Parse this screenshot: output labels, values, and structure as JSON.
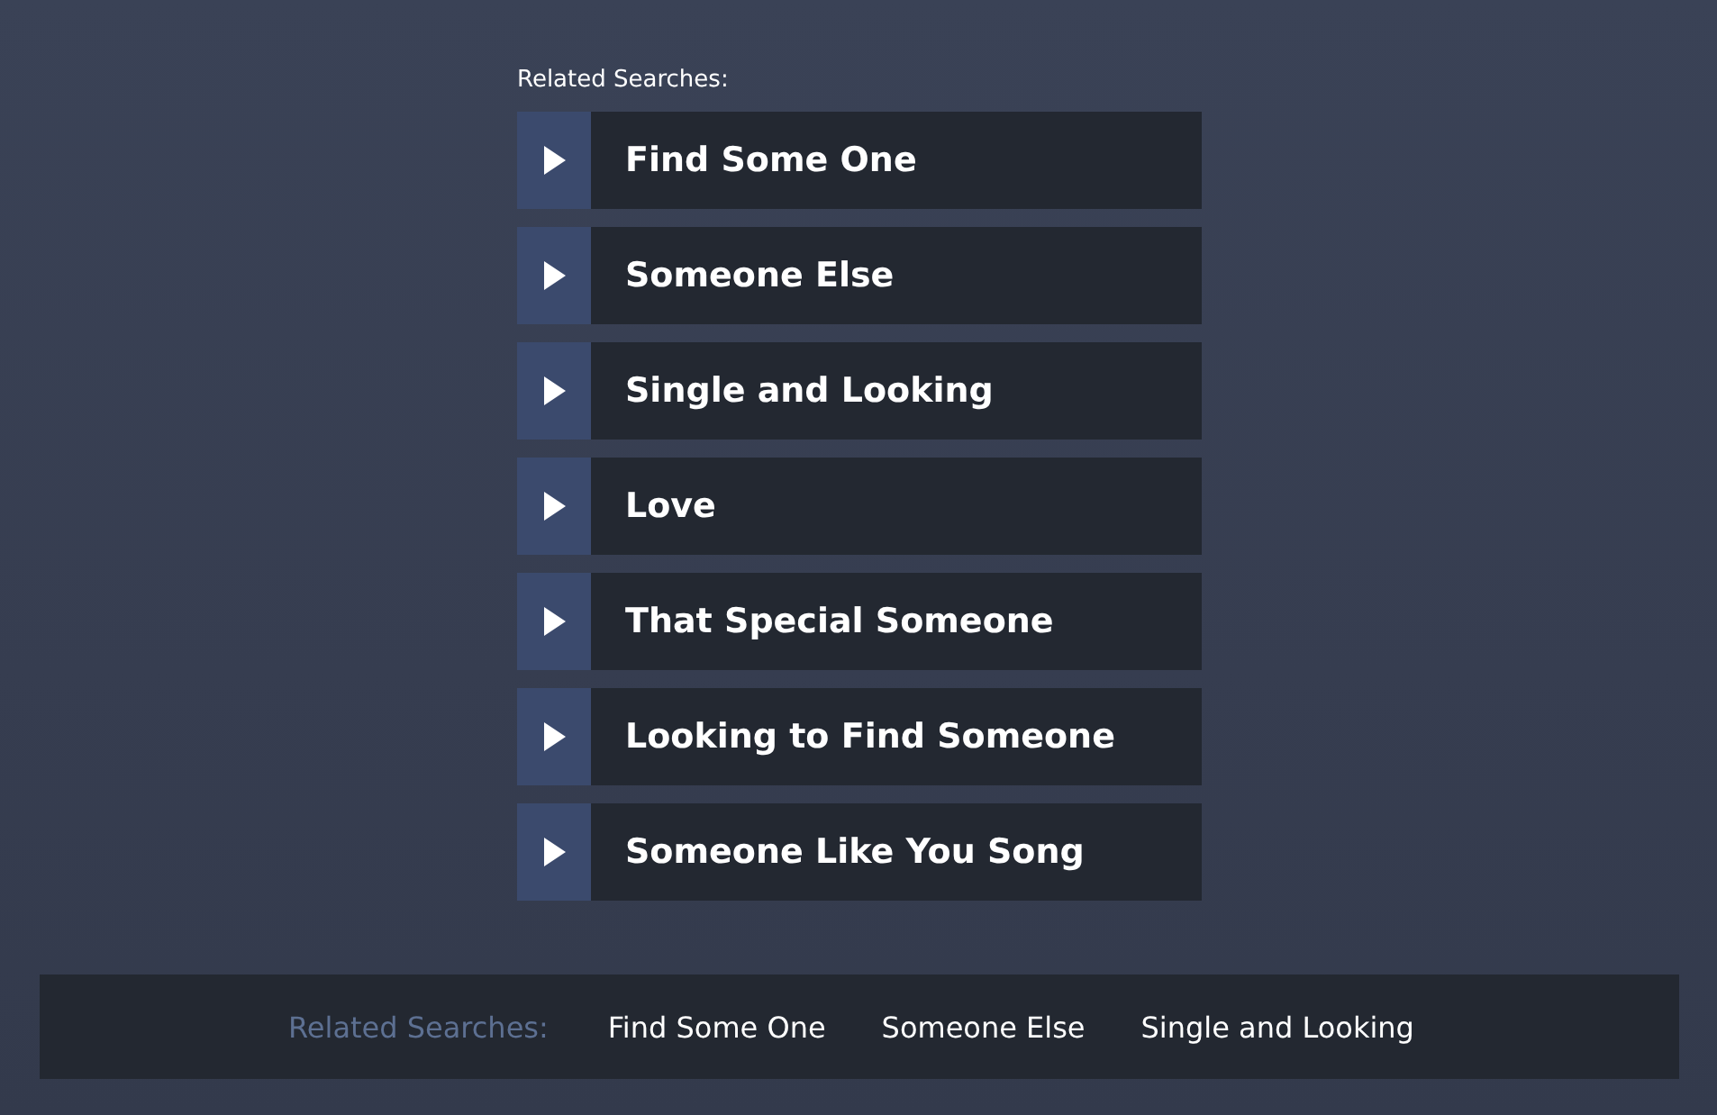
{
  "heading": "Related Searches:",
  "searches": [
    "Find Some One",
    "Someone Else",
    "Single and Looking",
    "Love",
    "That Special Someone",
    "Looking to Find Someone",
    "Someone Like You Song"
  ],
  "footer": {
    "label": "Related Searches:",
    "links": [
      "Find Some One",
      "Someone Else",
      "Single and Looking"
    ]
  }
}
